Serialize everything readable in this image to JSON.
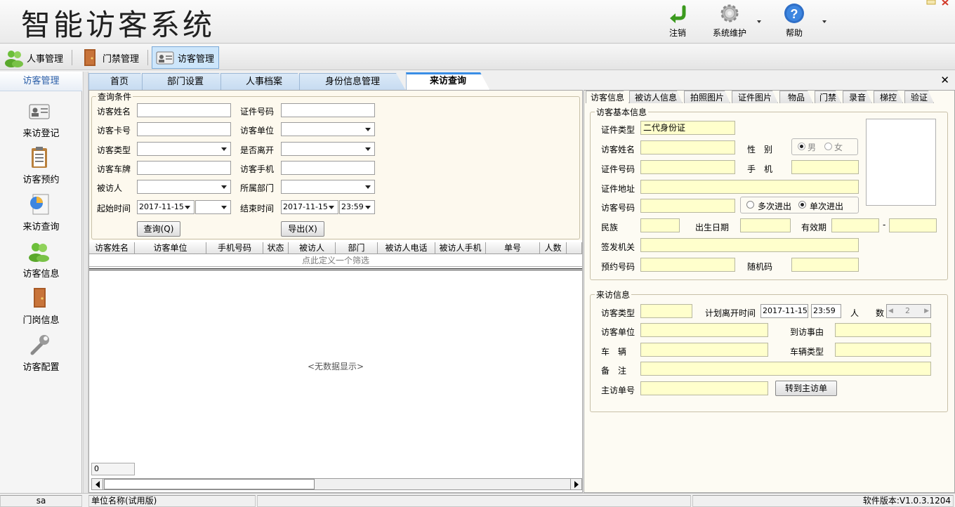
{
  "app": {
    "title": "智能访客系统"
  },
  "toolbar": {
    "logout": "注销",
    "maintenance": "系统维护",
    "help": "帮助"
  },
  "modules": [
    {
      "label": "人事管理"
    },
    {
      "label": "门禁管理"
    },
    {
      "label": "访客管理"
    }
  ],
  "sidebar": {
    "header": "访客管理",
    "items": [
      {
        "label": "来访登记",
        "icon": "id-card-icon"
      },
      {
        "label": "访客预约",
        "icon": "clipboard-icon"
      },
      {
        "label": "来访查询",
        "icon": "document-chart-icon"
      },
      {
        "label": "访客信息",
        "icon": "users-icon"
      },
      {
        "label": "门岗信息",
        "icon": "door-icon"
      },
      {
        "label": "访客配置",
        "icon": "wrench-icon"
      }
    ]
  },
  "tabs": [
    {
      "label": "首页"
    },
    {
      "label": "部门设置"
    },
    {
      "label": "人事档案"
    },
    {
      "label": "身份信息管理"
    },
    {
      "label": "来访查询"
    }
  ],
  "close_symbol": "✕",
  "query": {
    "legend": "查询条件",
    "visitor_name": "访客姓名",
    "id_number": "证件号码",
    "visitor_card": "访客卡号",
    "visitor_company": "访客单位",
    "visitor_type": "访客类型",
    "left": "是否离开",
    "plate": "访客车牌",
    "visitor_phone": "访客手机",
    "visitee": "被访人",
    "department": "所属部门",
    "start_time": "起始时间",
    "start_date_value": "2017-11-15",
    "end_time": "结束时间",
    "end_date_value": "2017-11-15",
    "end_time_value": "23:59",
    "search_button": "查询(Q)",
    "export_button": "导出(X)"
  },
  "grid": {
    "columns": [
      "访客姓名",
      "访客单位",
      "手机号码",
      "状态",
      "被访人",
      "部门",
      "被访人电话",
      "被访人手机",
      "单号",
      "人数"
    ],
    "filter_hint": "点此定义一个筛选",
    "empty_text": "<无数据显示>",
    "count": "0"
  },
  "detail": {
    "tabs": [
      "访客信息",
      "被访人信息",
      "拍照图片",
      "证件图片",
      "物品",
      "门禁",
      "录音",
      "梯控",
      "验证"
    ],
    "basic_legend": "访客基本信息",
    "id_type": "证件类型",
    "id_type_value": "二代身份证",
    "name": "访客姓名",
    "gender": "性　别",
    "male": "男",
    "female": "女",
    "id_number": "证件号码",
    "mobile": "手　机",
    "address": "证件地址",
    "visitor_no": "访客号码",
    "multi_entry": "多次进出",
    "single_entry": "单次进出",
    "ethnicity": "民族",
    "birth_date": "出生日期",
    "valid_period": "有效期",
    "dash": "-",
    "issuer": "签发机关",
    "reservation_no": "预约号码",
    "random_code": "随机码",
    "visit_legend": "来访信息",
    "visitor_type": "访客类型",
    "planned_leave": "计划离开时间",
    "leave_date_value": "2017-11-15",
    "leave_time_value": "23:59",
    "people": "人　　数",
    "people_value": "2",
    "company": "访客单位",
    "reason": "到访事由",
    "vehicle": "车　辆",
    "vehicle_type": "车辆类型",
    "remark": "备　注",
    "main_order": "主访单号",
    "transfer_button": "转到主访单"
  },
  "status": {
    "user": "sa",
    "unit": "单位名称(试用版)",
    "version": "软件版本:V1.0.3.1204"
  },
  "colors": {
    "accent": "#3a8ee6",
    "field_yellow": "#ffffcc",
    "panel_bg": "#fdf9ee"
  }
}
